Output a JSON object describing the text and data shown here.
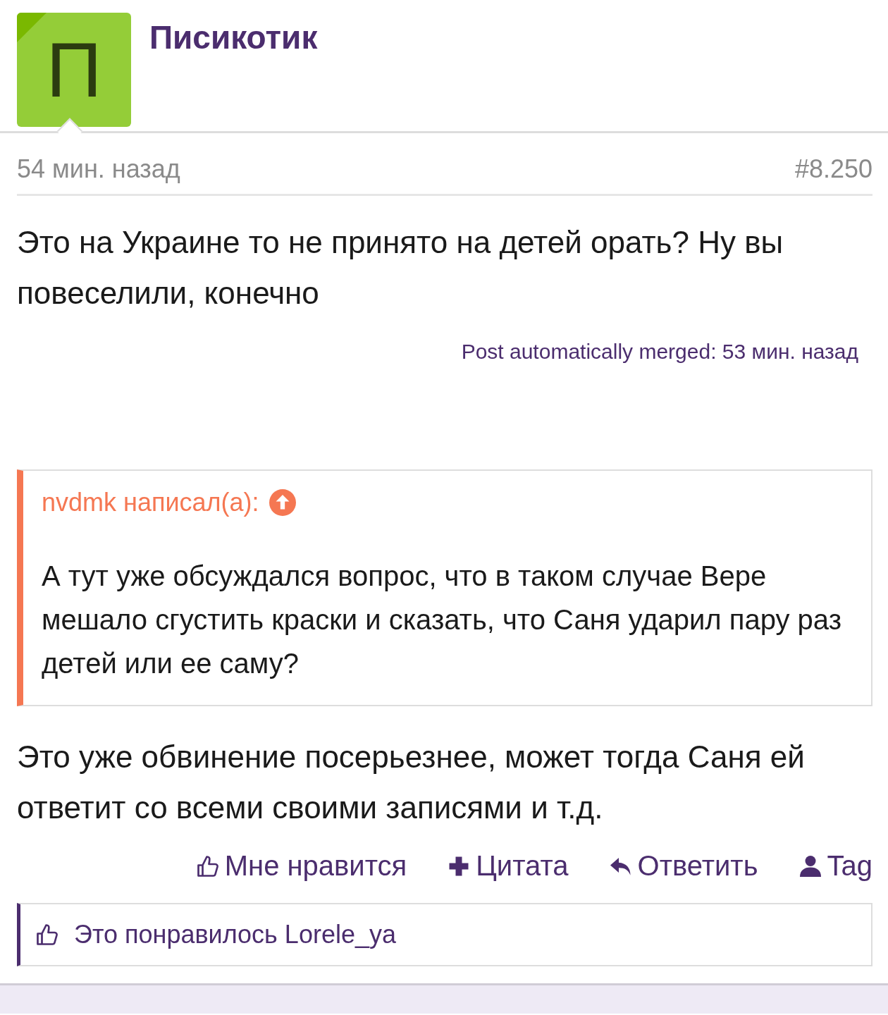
{
  "author": {
    "avatar_letter": "П",
    "name": "Писикотик"
  },
  "post": {
    "time": "54 мин. назад",
    "number": "#8.250",
    "text": "Это на Украине то не принято на детей орать? Ну вы повеселили, конечно",
    "merged": "Post automatically merged: 53 мин. назад",
    "quote": {
      "author": "nvdmk написал(а):",
      "text": "А тут уже обсуждался вопрос, что в таком случае Вере мешало сгустить краски и сказать, что Саня ударил пару раз детей или ее саму?"
    },
    "text_2": "Это уже обвинение посерьезнее, может тогда Саня ей ответит со всеми своими записями и т.д.",
    "actions": [
      {
        "kind": "like",
        "label": "Мне нравится"
      },
      {
        "kind": "quote",
        "label": "Цитата"
      },
      {
        "kind": "reply",
        "label": "Ответить"
      },
      {
        "kind": "tag",
        "label": "Tag"
      }
    ],
    "likes": {
      "prefix": "Это понравилось",
      "user": "Lorele_ya"
    }
  }
}
